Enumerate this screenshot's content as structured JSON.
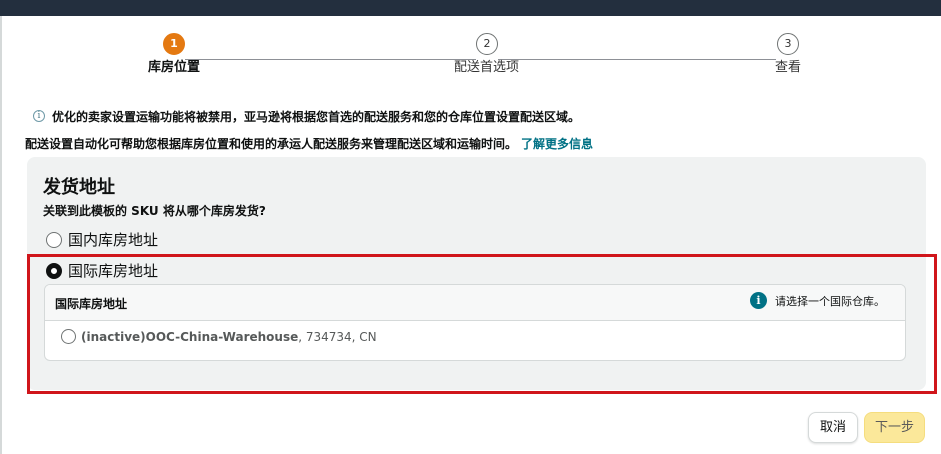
{
  "stepper": {
    "steps": [
      {
        "number": "1",
        "label": "库房位置",
        "active": true
      },
      {
        "number": "2",
        "label": "配送首选项",
        "active": false
      },
      {
        "number": "3",
        "label": "查看",
        "active": false
      }
    ]
  },
  "notice": {
    "icon": "info-icon",
    "text": "优化的卖家设置运输功能将被禁用，亚马逊将根据您首选的配送服务和您的仓库位置设置配送区域。"
  },
  "description": {
    "text": "配送设置自动化可帮助您根据库房位置和使用的承运人配送服务来管理配送区域和运输时间。",
    "link_label": "了解更多信息"
  },
  "ship_from": {
    "title": "发货地址",
    "question": "关联到此模板的 SKU 将从哪个库房发货?",
    "options": [
      {
        "label": "国内库房地址",
        "selected": false
      },
      {
        "label": "国际库房地址",
        "selected": true
      }
    ],
    "intl_box": {
      "header_label": "国际库房地址",
      "hint": "请选择一个国际仓库。",
      "warehouse_name": "(inactive)OOC-China-Warehouse",
      "warehouse_detail": ", 734734, CN"
    }
  },
  "footer": {
    "cancel_label": "取消",
    "next_label": "下一步"
  },
  "colors": {
    "active_step": "#e47911",
    "link": "#007185",
    "highlight_border": "#d0151b",
    "primary_button": "#fbe89a"
  }
}
